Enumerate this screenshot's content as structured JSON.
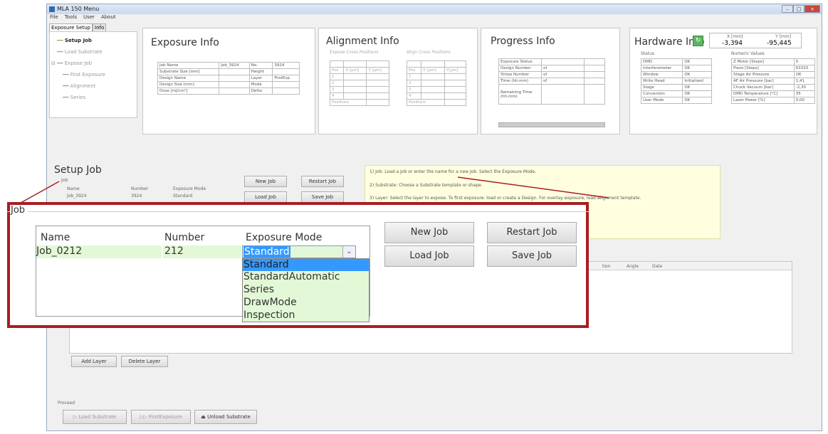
{
  "window": {
    "title": "MLA 150 Menu"
  },
  "menu": [
    "File",
    "Tools",
    "User",
    "About"
  ],
  "tabs": [
    "Exposure Setup",
    "Info"
  ],
  "tree": {
    "items": [
      "Setup Job",
      "Load Substrate",
      "Expose Job",
      "First Exposure",
      "Alignment",
      "Series"
    ]
  },
  "exposure_info": {
    "title": "Exposure Info",
    "rows": [
      [
        "Job Name",
        "Job_3924",
        "No.",
        "3924"
      ],
      [
        "Substrate Size [mm]",
        "",
        "Height",
        ""
      ],
      [
        "Design Name",
        "",
        "Layer",
        "FirstExp"
      ],
      [
        "Design Size [mm]",
        "",
        "Mode",
        ""
      ],
      [
        "Dose [mJ/cm²]",
        "",
        "Defoc",
        ""
      ]
    ]
  },
  "alignment_info": {
    "title": "Alignment Info",
    "sub1": "Expose Cross Positions",
    "sub2": "Align Cross Positions",
    "hdr1": [
      "Pos",
      "X [µm]",
      "Y [µm]"
    ],
    "hdr2": [
      "Pos",
      "X [µm]",
      "Y[µm]"
    ],
    "nums": [
      "1",
      "2",
      "3",
      "4"
    ],
    "footer": "Positions"
  },
  "progress_info": {
    "title": "Progress Info",
    "rows": [
      [
        "Exposure Status",
        "",
        ""
      ],
      [
        "Design Number",
        "of",
        ""
      ],
      [
        "Stripe Number",
        "of",
        ""
      ],
      [
        "Time (hh:mm)",
        "of",
        ""
      ],
      [
        "Remaining Time (hh:mm)",
        "",
        ""
      ]
    ]
  },
  "hardware_info": {
    "title": "Hardware Info",
    "x_label": "X [mm]",
    "y_label": "Y [mm]",
    "x_val": "-3,394",
    "y_val": "-95,445",
    "status_label": "Status",
    "numeric_label": "Numeric Values",
    "status": [
      [
        "DMD",
        "OK"
      ],
      [
        "Interferometer",
        "OK"
      ],
      [
        "Window",
        "OK"
      ],
      [
        "Write Head",
        "Initialized"
      ],
      [
        "Stage",
        "OK"
      ],
      [
        "Conversion",
        "OK"
      ],
      [
        "User Mode",
        "OK"
      ]
    ],
    "numeric": [
      [
        "Z Motor [Steps]",
        "0"
      ],
      [
        "Piezo [Steps]",
        "63333"
      ],
      [
        "Stage Air Pressure",
        "OK"
      ],
      [
        "AF Air Pressure [bar]",
        "1,41"
      ],
      [
        "Chuck Vacuum [bar]",
        "-2,30"
      ],
      [
        "DMD Temperature [°C]",
        "35"
      ],
      [
        "Laser Power [%]",
        "0,00"
      ]
    ]
  },
  "setup_job": {
    "title": "Setup Job",
    "group": "Job",
    "cols": [
      "Name",
      "Number",
      "Exposure Mode"
    ],
    "row": [
      "Job_3924",
      "3924",
      "Standard"
    ],
    "new_job": "New Job",
    "restart_job": "Restart Job",
    "load_job": "Load Job",
    "save_job": "Save Job"
  },
  "hints": [
    "1) Job: Load a Job or enter the name for a new Job. Select the Exposure Mode.",
    "2) Substrate: Choose a Substrate template or shape.",
    "3) Layer: Select the layer to expose. To first exposure: load or create a Design. For overlay exposure, load Alignment template."
  ],
  "grid_cols": [
    "tion",
    "Angle",
    "Date"
  ],
  "add_layer": "Add Layer",
  "delete_layer": "Delete Layer",
  "proceed": {
    "label": "Proceed",
    "load": "Load Substrate",
    "first": "FirstExposure",
    "unload": "Unload Substrate"
  },
  "zoom": {
    "group": "Job",
    "cols": [
      "Name",
      "Number",
      "Exposure Mode"
    ],
    "name": "Job_0212",
    "number": "212",
    "mode": "Standard",
    "options": [
      "Standard",
      "StandardAutomatic",
      "Series",
      "DrawMode",
      "Inspection"
    ],
    "new_job": "New Job",
    "restart_job": "Restart Job",
    "load_job": "Load Job",
    "save_job": "Save Job"
  },
  "colors": {
    "highlight_border": "#a81d22",
    "selection": "#3399ff",
    "field_green": "#e3f8d6"
  }
}
